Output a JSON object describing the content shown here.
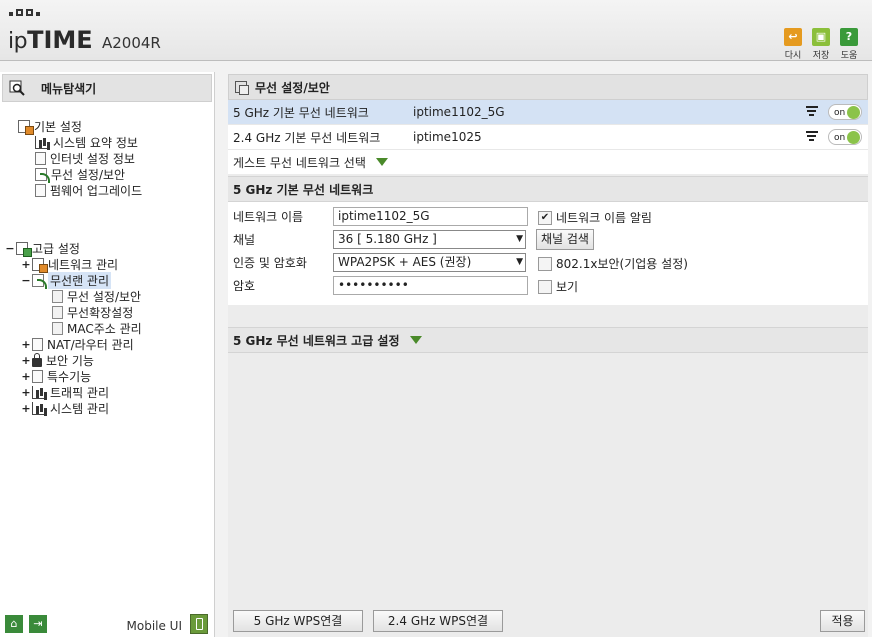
{
  "header": {
    "brand_prefix": "ip",
    "brand_bold": "TIME",
    "model": "A2004R",
    "buttons": [
      {
        "label": "다시",
        "icon": "back-icon"
      },
      {
        "label": "저장",
        "icon": "save-icon"
      },
      {
        "label": "도움",
        "icon": "help-icon"
      }
    ]
  },
  "sidebar": {
    "title": "메뉴탐색기",
    "basic": {
      "label": "기본 설정",
      "items": [
        "시스템 요약 정보",
        "인터넷 설정 정보",
        "무선 설정/보안",
        "펌웨어 업그레이드"
      ]
    },
    "advanced": {
      "toggle": "−",
      "label": "고급 설정",
      "network": {
        "toggle": "+",
        "label": "네트워크 관리"
      },
      "wireless": {
        "toggle": "−",
        "label": "무선랜 관리",
        "children": [
          "무선 설정/보안",
          "무선확장설정",
          "MAC주소 관리"
        ]
      },
      "others": [
        {
          "toggle": "+",
          "label": "NAT/라우터 관리"
        },
        {
          "toggle": "+",
          "label": "보안 기능"
        },
        {
          "toggle": "+",
          "label": "특수기능"
        },
        {
          "toggle": "+",
          "label": "트래픽 관리"
        },
        {
          "toggle": "+",
          "label": "시스템 관리"
        }
      ]
    },
    "mobile_label": "Mobile UI"
  },
  "main": {
    "title": "무선 설정/보안",
    "networks": [
      {
        "name": "5 GHz 기본 무선 네트워크",
        "ssid": "iptime1102_5G",
        "toggle": "on"
      },
      {
        "name": "2.4 GHz 기본 무선 네트워크",
        "ssid": "iptime1025",
        "toggle": "on"
      }
    ],
    "guest_label": "게스트 무선 네트워크 선택",
    "section_title": "5 GHz 기본 무선 네트워크",
    "form": {
      "name_label": "네트워크 이름",
      "name_value": "iptime1102_5G",
      "broadcast_label": "네트워크 이름 알림",
      "broadcast_checked": "✔",
      "channel_label": "채널",
      "channel_value": "36 [ 5.180 GHz ]",
      "scan_button": "채널 검색",
      "auth_label": "인증 및 암호화",
      "auth_value": "WPA2PSK + AES (권장)",
      "enterprise_label": "802.1x보안(기업용 설정)",
      "password_label": "암호",
      "password_value": "••••••••••",
      "show_label": "보기"
    },
    "advanced_title": "5 GHz 무선 네트워크 고급 설정",
    "footer": {
      "wps5_button": "5 GHz WPS연결",
      "wps24_button": "2.4 GHz WPS연결",
      "apply_button": "적용"
    }
  },
  "colors": {
    "active_row": "#d4e2f4",
    "toggle_on": "#8bc34a",
    "arrow_green": "#4a8a2a"
  }
}
